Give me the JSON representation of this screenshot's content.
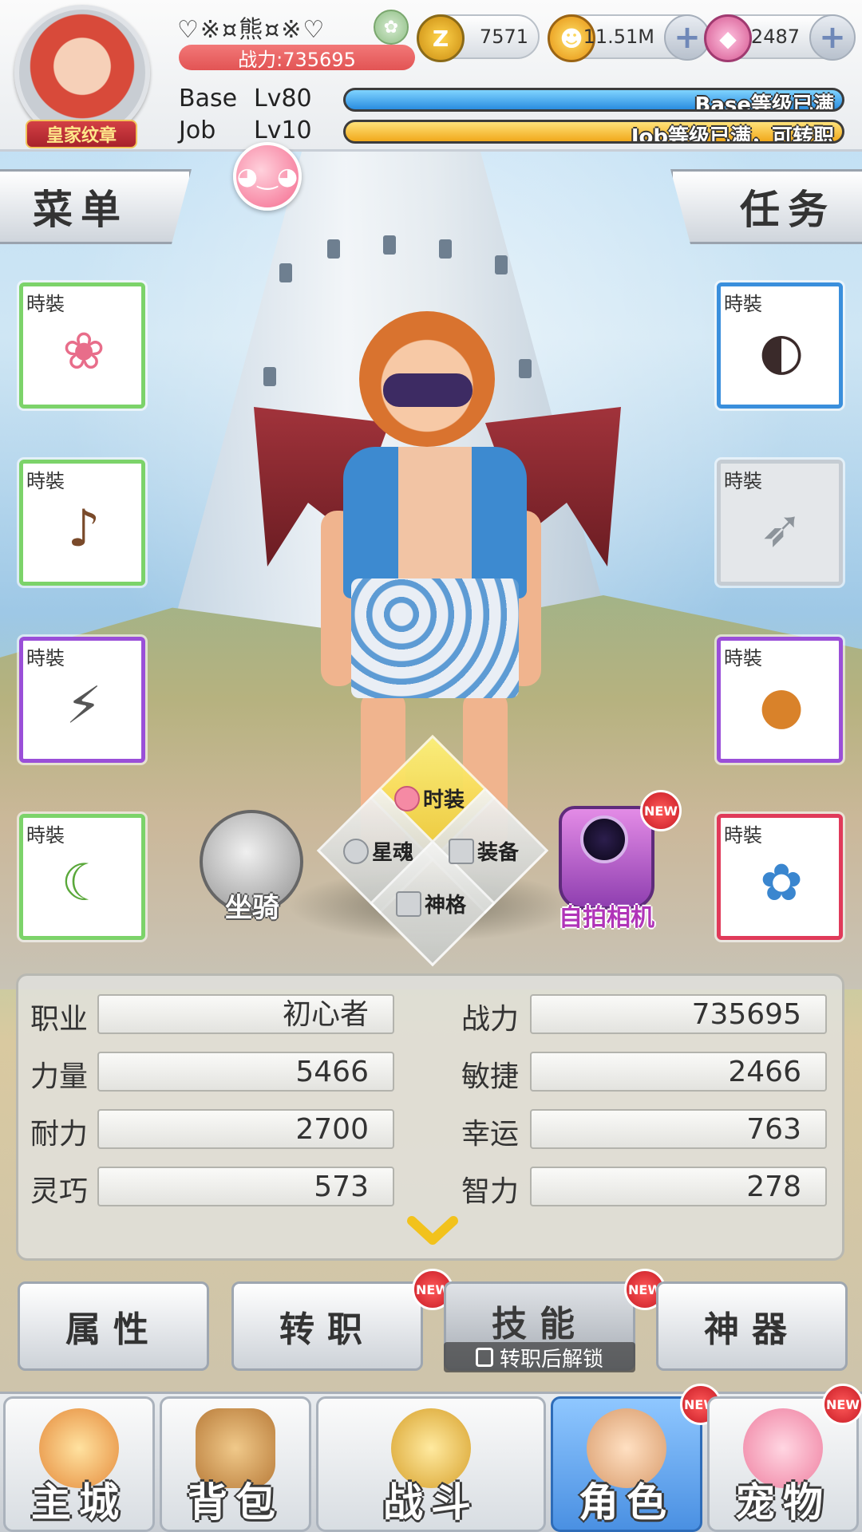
{
  "player": {
    "name": "♡※¤熊¤※♡",
    "power_label": "战力:735695",
    "badge": "皇家纹章",
    "base_label": "Base",
    "base_level": "Lv80",
    "base_status": "Base等级已满",
    "job_label": "Job",
    "job_level": "Lv10",
    "job_status": "Job等级已满，可转职",
    "base_progress": 1.0,
    "job_progress": 1.0
  },
  "currencies": [
    {
      "name": "zeny",
      "icon": "z-coin-icon",
      "value": "7571",
      "color": "#e9a21c",
      "has_plus": false
    },
    {
      "name": "gold",
      "icon": "gold-coin-icon",
      "value": "11.51M",
      "color": "#f0a31b",
      "has_plus": true
    },
    {
      "name": "gems",
      "icon": "pink-gem-icon",
      "value": "2487",
      "color": "#e76fa9",
      "has_plus": true
    }
  ],
  "side_tabs": {
    "menu": "菜单",
    "tasks": "任务"
  },
  "slots": {
    "tag": "時裝",
    "left": [
      {
        "icon": "flower-crown-icon",
        "border": "#7cd36a"
      },
      {
        "icon": "pipe-icon",
        "border": "#7cd36a"
      },
      {
        "icon": "bat-wings-icon",
        "border": "#9a4fd8"
      },
      {
        "icon": "green-tail-icon",
        "border": "#7cd36a"
      }
    ],
    "right": [
      {
        "icon": "eye-mask-icon",
        "border": "#3a8fdc"
      },
      {
        "icon": "spear-icon",
        "border": "#c5ccd3"
      },
      {
        "icon": "wig-icon",
        "border": "#9a4fd8"
      },
      {
        "icon": "hawaiian-outfit-icon",
        "border": "#e03a5a"
      }
    ]
  },
  "radial_menu": {
    "fashion": "时装",
    "star_soul": "星魂",
    "equipment": "装备",
    "divinity": "神格"
  },
  "mount_label": "坐骑",
  "camera_label": "自拍相机",
  "new_label": "NEW",
  "stats": [
    {
      "name": "职业",
      "value": "初心者"
    },
    {
      "name": "战力",
      "value": "735695"
    },
    {
      "name": "力量",
      "value": "5466"
    },
    {
      "name": "敏捷",
      "value": "2466"
    },
    {
      "name": "耐力",
      "value": "2700"
    },
    {
      "name": "幸运",
      "value": "763"
    },
    {
      "name": "灵巧",
      "value": "573"
    },
    {
      "name": "智力",
      "value": "278"
    }
  ],
  "tabs": {
    "attributes": "属性",
    "job_change": "转职",
    "skills": "技能",
    "skills_lock": "转职后解锁",
    "artifact": "神器"
  },
  "bottom_nav": [
    {
      "label": "主城",
      "icon": "castle-icon",
      "active": false,
      "new": false
    },
    {
      "label": "背包",
      "icon": "backpack-icon",
      "active": false,
      "new": false
    },
    {
      "label": "战斗",
      "icon": "crossed-swords-icon",
      "active": false,
      "new": false
    },
    {
      "label": "角色",
      "icon": "character-icon",
      "active": true,
      "new": true
    },
    {
      "label": "宠物",
      "icon": "poring-pet-icon",
      "active": false,
      "new": true
    }
  ]
}
